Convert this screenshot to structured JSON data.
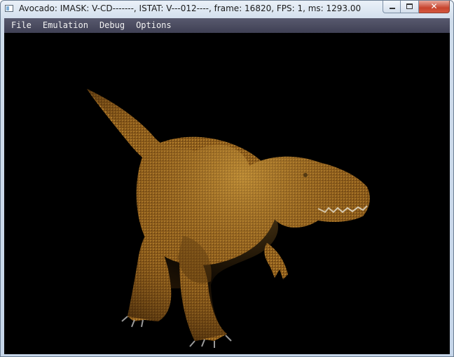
{
  "window": {
    "title": "Avocado: IMASK: V-CD-------, ISTAT: V---012----, frame: 16820, FPS: 1, ms: 1293.00",
    "close_glyph": "✕"
  },
  "menu": {
    "items": [
      "File",
      "Emulation",
      "Debug",
      "Options"
    ]
  },
  "viewport": {
    "scene": "t-rex-render",
    "background": "#000000"
  },
  "colors": {
    "menubar": "#4a4b5f",
    "menu_text": "#f2f2f2",
    "dino_body": "#8a5a1a",
    "dino_highlight": "#c99a3a",
    "dino_shadow": "#4a2c0a"
  }
}
